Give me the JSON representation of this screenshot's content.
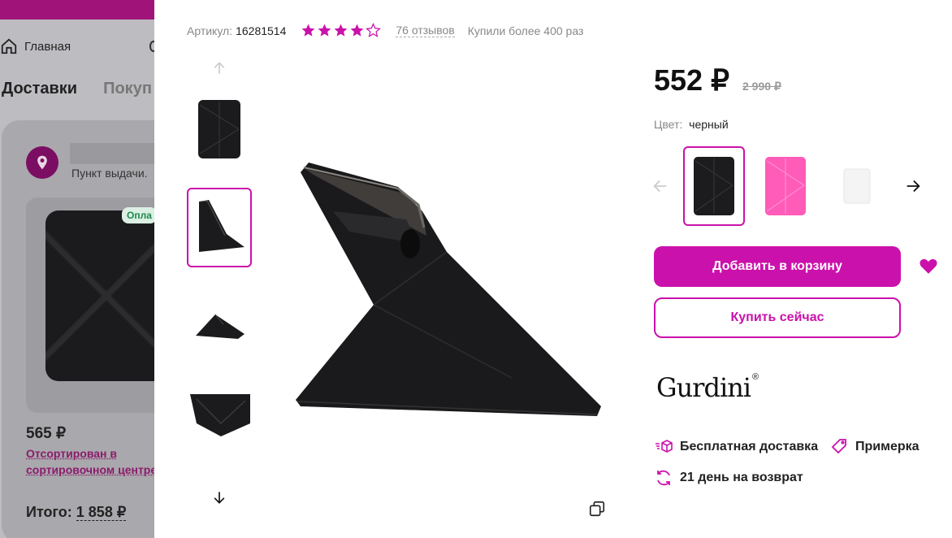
{
  "background": {
    "nav": {
      "home_label": "Главная"
    },
    "tabs": [
      "Доставки",
      "Покуп"
    ],
    "pickup": {
      "label": "Пункт выдачи."
    },
    "order": {
      "paid_badge": "Опла",
      "price": "565 ₽",
      "status": "Отсортирован в сортировочном центре",
      "total_label": "Итого:",
      "total_amount": "1 858 ₽"
    }
  },
  "product": {
    "sku_label": "Артикул:",
    "sku": "16281514",
    "rating": 4,
    "reviews": "76 отзывов",
    "bought": "Купили более 400 раз",
    "price": "552 ₽",
    "old_price": "2 990 ₽",
    "color_label": "Цвет:",
    "color_value": "черный",
    "swatches": [
      {
        "name": "black",
        "color": "#1c1c1e"
      },
      {
        "name": "pink",
        "color": "#ff5bb8"
      },
      {
        "name": "white",
        "color": "#f4f4f4"
      }
    ],
    "add_to_cart": "Добавить в корзину",
    "buy_now": "Купить сейчас",
    "brand": "Gurdini",
    "brand_mark": "®",
    "features": {
      "free_delivery": "Бесплатная доставка",
      "fitting": "Примерка",
      "return": "21 день на возврат"
    }
  },
  "colors": {
    "accent": "#cb11ab",
    "topbar": "#a0147a"
  }
}
